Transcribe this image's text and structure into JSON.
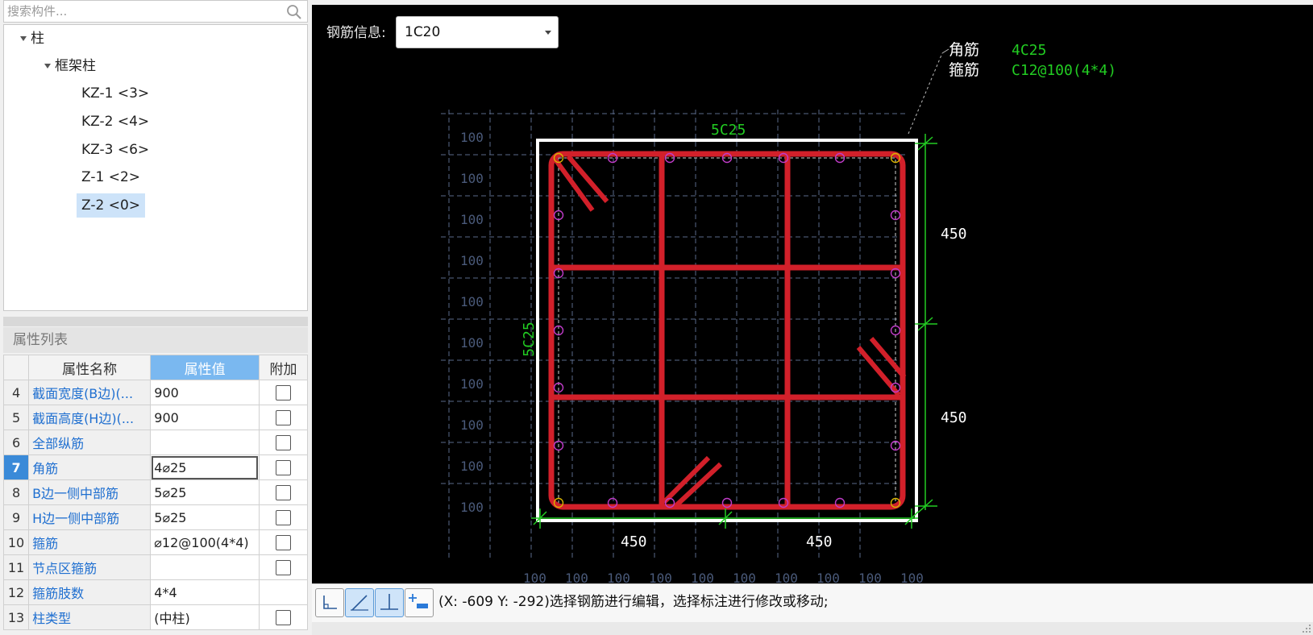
{
  "search": {
    "placeholder": "搜索构件..."
  },
  "tree": {
    "root": "柱",
    "group": "框架柱",
    "items": [
      {
        "label": "KZ-1 <3>"
      },
      {
        "label": "KZ-2 <4>"
      },
      {
        "label": "KZ-3 <6>"
      },
      {
        "label": "Z-1 <2>"
      },
      {
        "label": "Z-2 <0>",
        "selected": true
      }
    ]
  },
  "properties": {
    "title": "属性列表",
    "headers": {
      "name": "属性名称",
      "value": "属性值",
      "extra": "附加"
    },
    "rows": [
      {
        "num": "4",
        "name": "截面宽度(B边)(...",
        "value": "900",
        "checkbox": true
      },
      {
        "num": "5",
        "name": "截面高度(H边)(...",
        "value": "900",
        "checkbox": true
      },
      {
        "num": "6",
        "name": "全部纵筋",
        "value": "",
        "checkbox": true
      },
      {
        "num": "7",
        "name": "角筋",
        "value": "4⌀25",
        "checkbox": true,
        "highlighted": true
      },
      {
        "num": "8",
        "name": "B边一侧中部筋",
        "value": "5⌀25",
        "checkbox": true
      },
      {
        "num": "9",
        "name": "H边一侧中部筋",
        "value": "5⌀25",
        "checkbox": true
      },
      {
        "num": "10",
        "name": "箍筋",
        "value": "⌀12@100(4*4)",
        "checkbox": true
      },
      {
        "num": "11",
        "name": "节点区箍筋",
        "value": "",
        "checkbox": true
      },
      {
        "num": "12",
        "name": "箍筋肢数",
        "value": "4*4",
        "checkbox": false
      },
      {
        "num": "13",
        "name": "柱类型",
        "value": "(中柱)",
        "checkbox": true
      }
    ]
  },
  "editor": {
    "rebar_info_label": "钢筋信息:",
    "rebar_select_value": "1C20"
  },
  "drawing": {
    "top_label": "5C25",
    "left_label": "5C25",
    "corner_title": "角筋",
    "corner_value": "4C25",
    "stirrup_title": "箍筋",
    "stirrup_value": "C12@100(4*4)",
    "dim_right": [
      "450",
      "450"
    ],
    "dim_bottom": [
      "450",
      "450"
    ],
    "grid_labels": [
      "100",
      "100",
      "100",
      "100",
      "100",
      "100",
      "100",
      "100",
      "100",
      "100"
    ],
    "bottom_grid_label": "100",
    "colors": {
      "background": "#000000",
      "outline": "#ffffff",
      "rebar": "#d2202a",
      "dim": "#22cc22",
      "bar_mid": "#c03cc8",
      "bar_corner": "#d8b400",
      "grid": "#5a6a8a"
    }
  },
  "status": {
    "tools": [
      "corner-tool-icon",
      "line-tool-icon",
      "perpendicular-tool-icon",
      "add-rebar-icon"
    ],
    "text": "(X: -609 Y: -292)选择钢筋进行编辑，选择标注进行修改或移动;"
  }
}
